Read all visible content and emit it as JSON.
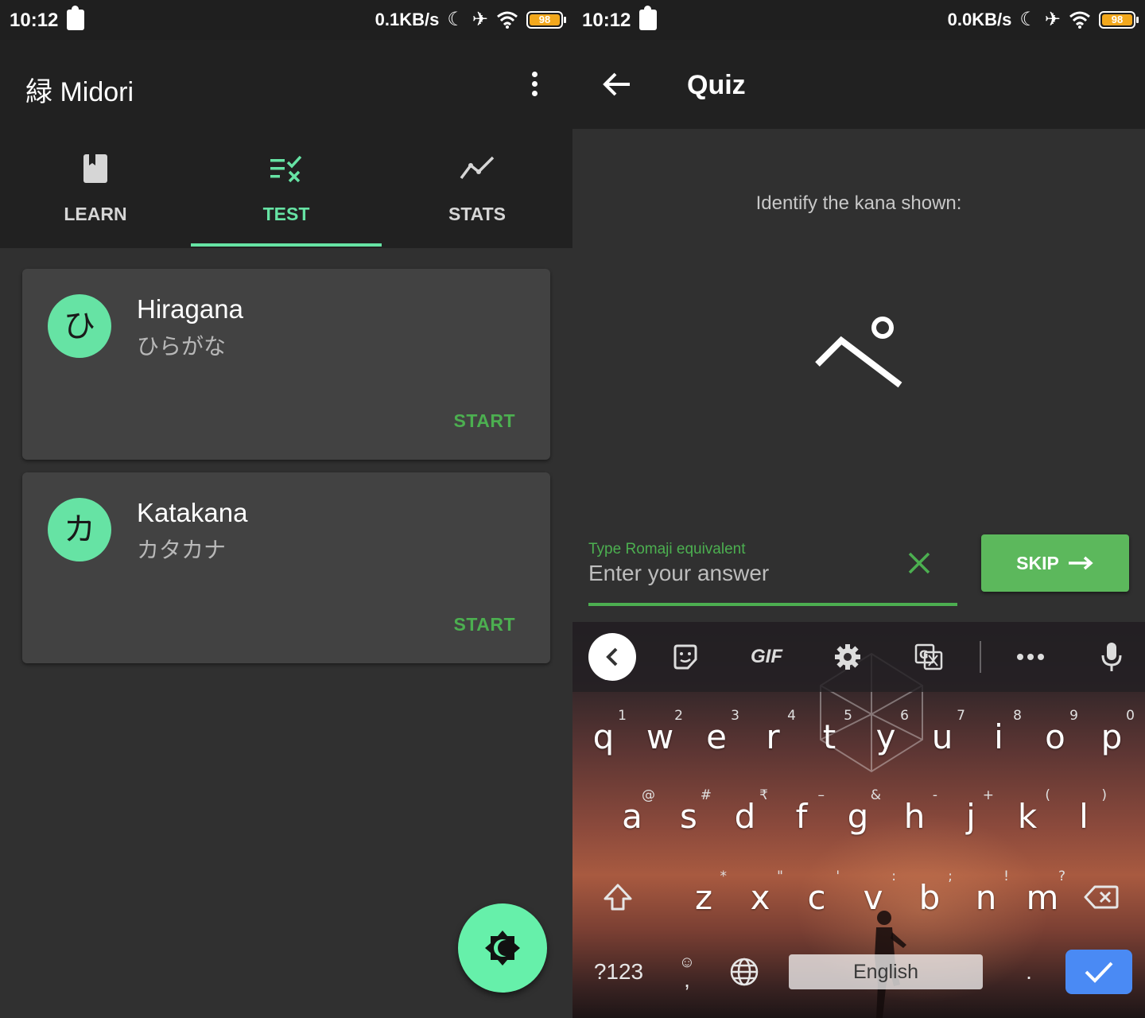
{
  "left_screen": {
    "status_bar": {
      "time": "10:12",
      "speed": "0.1KB/s",
      "battery": "98"
    },
    "app_bar": {
      "title": "緑 Midori"
    },
    "tabs": [
      {
        "label": "LEARN",
        "icon": "book-icon",
        "active": false
      },
      {
        "label": "TEST",
        "icon": "checklist-icon",
        "active": true
      },
      {
        "label": "STATS",
        "icon": "trend-icon",
        "active": false
      }
    ],
    "cards": [
      {
        "avatar": "ひ",
        "title": "Hiragana",
        "subtitle": "ひらがな",
        "action": "START"
      },
      {
        "avatar": "カ",
        "title": "Katakana",
        "subtitle": "カタカナ",
        "action": "START"
      }
    ],
    "fab": {
      "icon": "theme-toggle-icon"
    }
  },
  "right_screen": {
    "status_bar": {
      "time": "10:12",
      "speed": "0.0KB/s",
      "battery": "98"
    },
    "app_bar": {
      "title": "Quiz"
    },
    "prompt": "Identify the kana shown:",
    "kana_shown": "ぺ",
    "answer_field": {
      "label": "Type Romaji equivalent",
      "placeholder": "Enter your answer",
      "value": ""
    },
    "skip_button": {
      "label": "SKIP"
    },
    "keyboard": {
      "toolbar": {
        "gif": "GIF"
      },
      "row1": [
        {
          "ch": "q",
          "hint": "1"
        },
        {
          "ch": "w",
          "hint": "2"
        },
        {
          "ch": "e",
          "hint": "3"
        },
        {
          "ch": "r",
          "hint": "4"
        },
        {
          "ch": "t",
          "hint": "5"
        },
        {
          "ch": "y",
          "hint": "6"
        },
        {
          "ch": "u",
          "hint": "7"
        },
        {
          "ch": "i",
          "hint": "8"
        },
        {
          "ch": "o",
          "hint": "9"
        },
        {
          "ch": "p",
          "hint": "0"
        }
      ],
      "row2": [
        {
          "ch": "a",
          "hint": "@"
        },
        {
          "ch": "s",
          "hint": "#"
        },
        {
          "ch": "d",
          "hint": "₹"
        },
        {
          "ch": "f",
          "hint": "–"
        },
        {
          "ch": "g",
          "hint": "&"
        },
        {
          "ch": "h",
          "hint": "-"
        },
        {
          "ch": "j",
          "hint": "+"
        },
        {
          "ch": "k",
          "hint": "("
        },
        {
          "ch": "l",
          "hint": ")"
        }
      ],
      "row3": [
        {
          "ch": "z",
          "hint": "*"
        },
        {
          "ch": "x",
          "hint": "\""
        },
        {
          "ch": "c",
          "hint": "'"
        },
        {
          "ch": "v",
          "hint": ":"
        },
        {
          "ch": "b",
          "hint": ";"
        },
        {
          "ch": "n",
          "hint": "!"
        },
        {
          "ch": "m",
          "hint": "?"
        }
      ],
      "symbols_key": "?123",
      "comma_key": ",",
      "space_label": "English",
      "period_key": "."
    }
  },
  "colors": {
    "accent": "#66e3a4",
    "action_green": "#4caf50",
    "skip_green": "#5cb85c",
    "surface": "#424242",
    "background": "#303030",
    "bar": "#212121",
    "enter_blue": "#4a8af4"
  }
}
